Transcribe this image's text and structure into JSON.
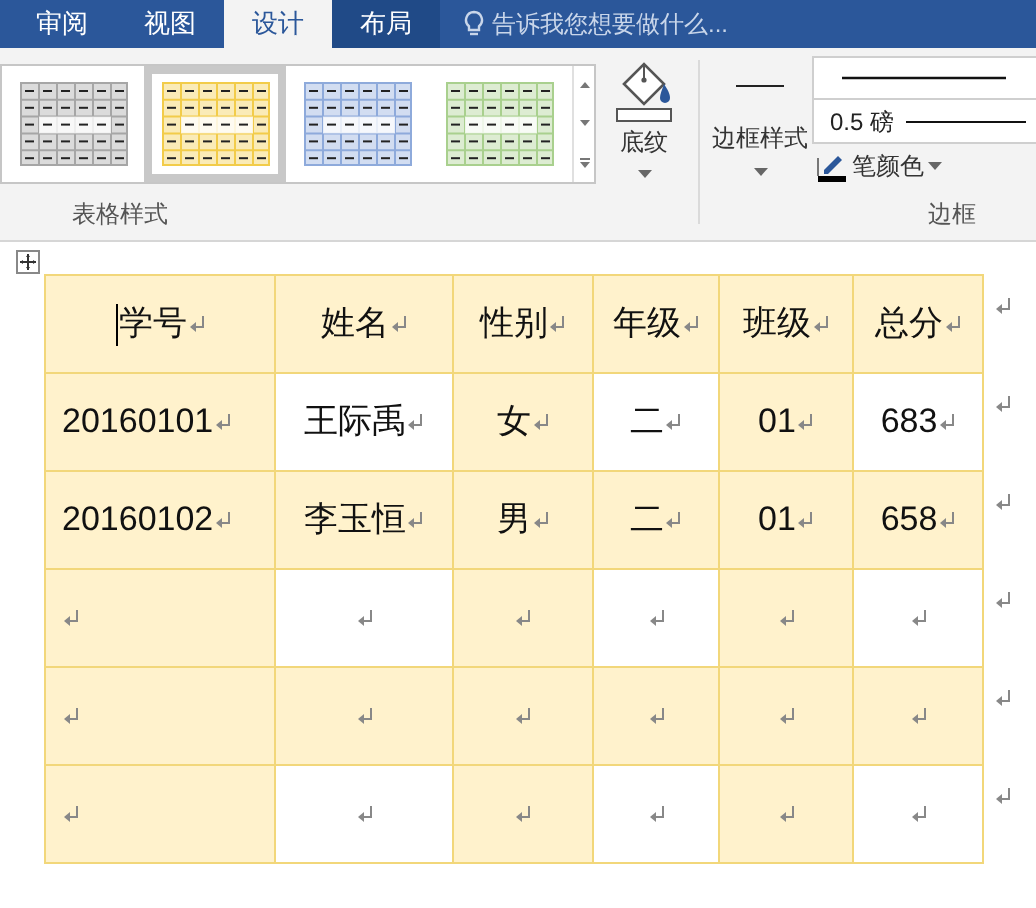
{
  "tabs": [
    {
      "label": "审阅",
      "selected": false,
      "highlighted": false
    },
    {
      "label": "视图",
      "selected": false,
      "highlighted": false
    },
    {
      "label": "设计",
      "selected": true,
      "highlighted": false
    },
    {
      "label": "布局",
      "selected": false,
      "highlighted": true
    }
  ],
  "tell_me": {
    "label": "告诉我您想要做什么..."
  },
  "table_styles": {
    "label": "表格样式",
    "styles": [
      {
        "color": "#a6a6a6",
        "selected": false
      },
      {
        "color": "#f2cc4a",
        "selected": true
      },
      {
        "color": "#8eaadb",
        "selected": false
      },
      {
        "color": "#a9d08e",
        "selected": false
      }
    ]
  },
  "shading_button": {
    "label": "底纹"
  },
  "borders": {
    "label": "边框",
    "border_styles_button": "边框样式",
    "line_weight": "0.5 磅",
    "pen_color": "笔颜色"
  },
  "show_formatting_marks": true,
  "table": {
    "columns": [
      {
        "shaded": true
      },
      {
        "shaded": false
      },
      {
        "shaded": true
      },
      {
        "shaded": false
      },
      {
        "shaded": true
      },
      {
        "shaded": false
      }
    ],
    "header": [
      "学号",
      "姓名",
      "性别",
      "年级",
      "班级",
      "总分"
    ],
    "rows": [
      {
        "shaded": false,
        "cells": [
          "20160101",
          "王际禹",
          "女",
          "二",
          "01",
          "683"
        ]
      },
      {
        "shaded": true,
        "cells": [
          "20160102",
          "李玉恒",
          "男",
          "二",
          "01",
          "658"
        ]
      },
      {
        "shaded": false
      },
      {
        "shaded": true
      },
      {
        "shaded": false
      }
    ]
  }
}
